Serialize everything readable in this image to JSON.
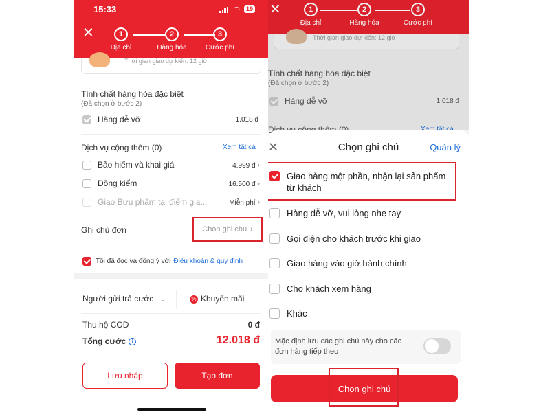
{
  "colors": {
    "brand_red": "#e8232d",
    "link_blue": "#1e6fd9",
    "highlight_red": "#d9232d"
  },
  "status_bar": {
    "time": "15:33",
    "battery": "19"
  },
  "stepper": {
    "steps": [
      {
        "number": "1",
        "label": "Địa chỉ"
      },
      {
        "number": "2",
        "label": "Hàng hóa"
      },
      {
        "number": "3",
        "label": "Cước phí"
      }
    ]
  },
  "left": {
    "delivery_time": "Thời gian giao dự kiến: 12 giờ",
    "special_goods": {
      "title": "Tính chất hàng hóa đặc biệt",
      "subtitle": "(Đã chọn ở bước 2)",
      "item": {
        "label": "Hàng dễ vỡ",
        "price": "1.018 đ",
        "checked": true
      }
    },
    "extra_services": {
      "title": "Dịch vụ cộng thêm (0)",
      "see_all": "Xem tất cả",
      "items": [
        {
          "label": "Bảo hiểm và khai giá",
          "value": "4.999 đ",
          "checked": false,
          "disabled": false
        },
        {
          "label": "Đồng kiểm",
          "value": "16.500 đ",
          "checked": false,
          "disabled": false
        },
        {
          "label": "Giao Bưu phẩm tại điểm gia...",
          "value": "Miễn phí",
          "checked": false,
          "disabled": true
        }
      ]
    },
    "order_note": {
      "label": "Ghi chú đơn",
      "placeholder": "Chọn ghi chú"
    },
    "agreement": {
      "text": "Tôi đã đọc và đồng ý với",
      "link": "Điều khoản & quy định",
      "checked": true
    },
    "payer": {
      "label": "Người gửi trả cước"
    },
    "promo": {
      "label": "Khuyến mãi"
    },
    "cod": {
      "label": "Thu hộ COD",
      "value": "0 đ"
    },
    "total": {
      "label": "Tổng cước",
      "value": "12.018 đ"
    },
    "buttons": {
      "draft": "Lưu nháp",
      "create": "Tạo đơn"
    }
  },
  "right": {
    "bg": {
      "delivery_time": "Thời gian giao dự kiến: 12 giờ",
      "special_goods": {
        "title": "Tính chất hàng hóa đặc biệt",
        "subtitle": "(Đã chọn ở bước 2)",
        "item": {
          "label": "Hàng dễ vỡ",
          "price": "1.018 đ"
        }
      },
      "extra_services": {
        "title": "Dịch vụ cộng thêm (0)",
        "see_all": "Xem tất cả"
      }
    },
    "sheet": {
      "title": "Chọn ghi chú",
      "manage": "Quản lý",
      "options": [
        {
          "label": "Giao hàng một phần, nhận lại sản phẩm từ khách",
          "checked": true
        },
        {
          "label": "Hàng dễ vỡ, vui lòng nhẹ tay",
          "checked": false
        },
        {
          "label": "Gọi điện cho khách trước khi giao",
          "checked": false
        },
        {
          "label": "Giao hàng vào giờ hành chính",
          "checked": false
        },
        {
          "label": "Cho khách xem hàng",
          "checked": false
        },
        {
          "label": "Khác",
          "checked": false
        }
      ],
      "save_default": {
        "text": "Mặc định lưu các ghi chú này cho các đơn hàng tiếp theo",
        "on": false
      },
      "confirm_button": "Chọn ghi chú"
    }
  }
}
